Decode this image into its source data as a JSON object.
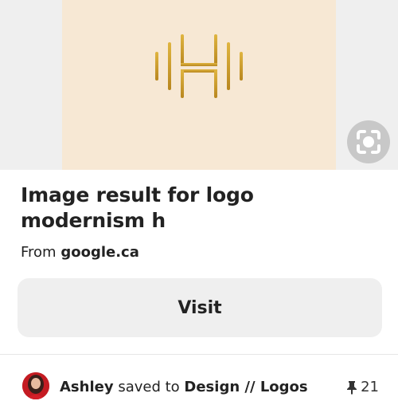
{
  "pin": {
    "title": "Image result for logo modernism h",
    "source_prefix": "From",
    "source_domain": "google.ca",
    "image_bg": "#f7e8d4",
    "logo_color": "#c9982a"
  },
  "actions": {
    "visit_label": "Visit"
  },
  "saver": {
    "name": "Ashley",
    "verb": "saved to",
    "board": "Design // Logos",
    "repin_count": "21"
  }
}
